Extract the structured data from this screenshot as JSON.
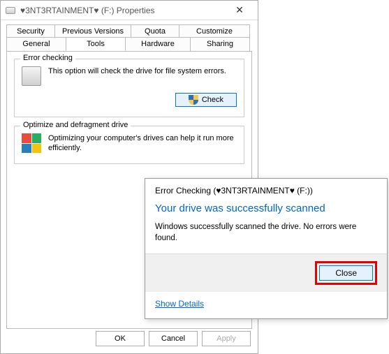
{
  "propsWindow": {
    "title": "♥3NT3RTAINMENT♥ (F:) Properties",
    "tabs": {
      "row1": [
        "Security",
        "Previous Versions",
        "Quota",
        "Customize"
      ],
      "row2": [
        "General",
        "Tools",
        "Hardware",
        "Sharing"
      ],
      "active": "Tools"
    },
    "errorChecking": {
      "groupTitle": "Error checking",
      "text": "This option will check the drive for file system errors.",
      "buttonLabel": "Check"
    },
    "defrag": {
      "groupTitle": "Optimize and defragment drive",
      "text": "Optimizing your computer's drives can help it run more efficiently."
    },
    "buttons": {
      "ok": "OK",
      "cancel": "Cancel",
      "apply": "Apply"
    }
  },
  "errorDialog": {
    "header": "Error Checking (♥3NT3RTAINMENT♥ (F:))",
    "headline": "Your drive was successfully scanned",
    "body": "Windows successfully scanned the drive. No errors were found.",
    "closeLabel": "Close",
    "detailsLabel": "Show Details"
  }
}
